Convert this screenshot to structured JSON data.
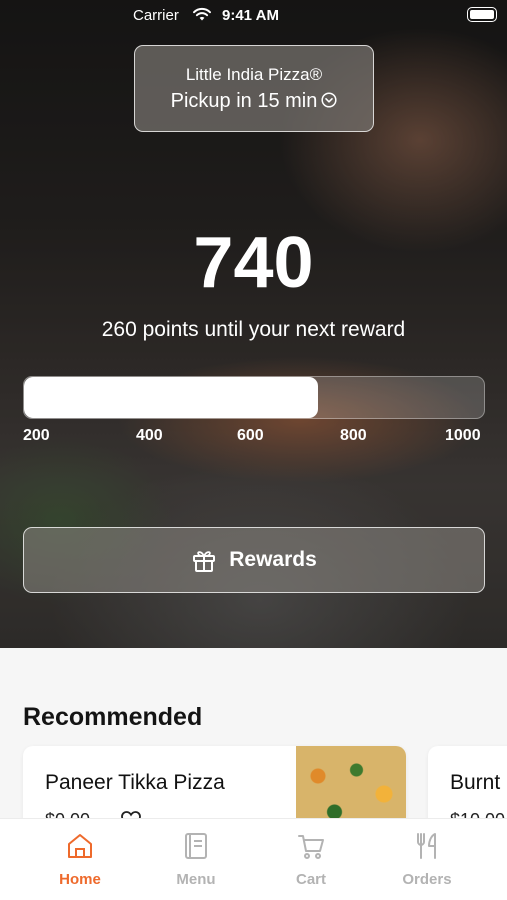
{
  "status_bar": {
    "carrier": "Carrier",
    "time": "9:41 AM"
  },
  "store": {
    "name": "Little India Pizza®",
    "pickup": "Pickup in 15 min"
  },
  "rewards": {
    "points": "740",
    "subtitle": "260 points until your next reward",
    "progress_fraction": 0.64,
    "ticks": [
      "200",
      "400",
      "600",
      "800",
      "1000"
    ],
    "button_label": "Rewards"
  },
  "recommended": {
    "title": "Recommended",
    "items": [
      {
        "name": "Paneer Tikka Pizza"
      },
      {
        "name": "Burnt"
      }
    ]
  },
  "tabs": [
    {
      "label": "Home",
      "icon": "home-icon",
      "active": true
    },
    {
      "label": "Menu",
      "icon": "menu-icon",
      "active": false
    },
    {
      "label": "Cart",
      "icon": "cart-icon",
      "active": false
    },
    {
      "label": "Orders",
      "icon": "fork-knife-icon",
      "active": false
    }
  ],
  "colors": {
    "accent": "#ee6a2c",
    "inactive": "#b3b3b3"
  }
}
